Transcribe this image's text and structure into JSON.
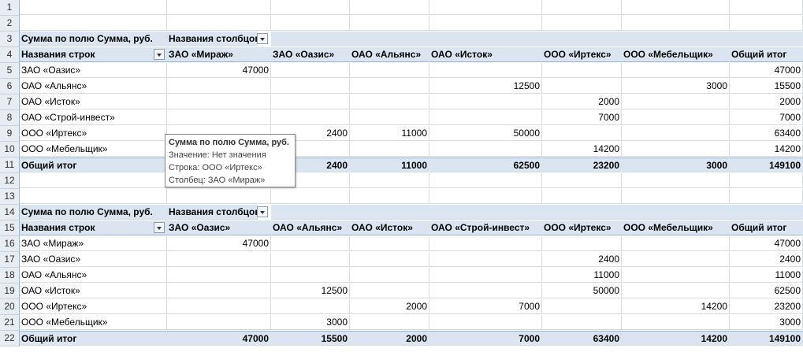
{
  "row_numbers": [
    "1",
    "2",
    "3",
    "4",
    "5",
    "6",
    "7",
    "8",
    "9",
    "10",
    "11",
    "12",
    "13",
    "14",
    "15",
    "16",
    "17",
    "18",
    "19",
    "20",
    "21",
    "22"
  ],
  "pivot1": {
    "data_label": "Сумма по полю Сумма, руб.",
    "columns_label": "Названия столбцов",
    "rows_label": "Названия строк",
    "columns": [
      "ЗАО «Мираж»",
      "ЗАО «Оазис»",
      "ОАО «Альянс»",
      "ОАО «Исток»",
      "ООО «Иртекс»",
      "ООО «Мебельщик»",
      "Общий итог"
    ],
    "rows": [
      {
        "label": "ЗАО «Оазис»",
        "v": [
          "47000",
          "",
          "",
          "",
          "",
          "",
          "47000"
        ]
      },
      {
        "label": "ОАО «Альянс»",
        "v": [
          "",
          "",
          "",
          "12500",
          "",
          "3000",
          "15500"
        ]
      },
      {
        "label": "ОАО «Исток»",
        "v": [
          "",
          "",
          "",
          "",
          "2000",
          "",
          "2000"
        ]
      },
      {
        "label": "ОАО «Строй-инвест»",
        "v": [
          "",
          "",
          "",
          "",
          "7000",
          "",
          "7000"
        ]
      },
      {
        "label": "ООО «Иртекс»",
        "v": [
          "",
          "2400",
          "11000",
          "50000",
          "",
          "",
          "63400"
        ]
      },
      {
        "label": "ООО «Мебельщик»",
        "v": [
          "",
          "",
          "",
          "",
          "14200",
          "",
          "14200"
        ]
      }
    ],
    "total": {
      "label": "Общий итог",
      "v": [
        "",
        "2400",
        "11000",
        "62500",
        "23200",
        "3000",
        "149100"
      ]
    }
  },
  "pivot2": {
    "data_label": "Сумма по полю Сумма, руб.",
    "columns_label": "Названия столбцов",
    "rows_label": "Названия строк",
    "columns": [
      "ЗАО «Оазис»",
      "ОАО «Альянс»",
      "ОАО «Исток»",
      "ОАО «Строй-инвест»",
      "ООО «Иртекс»",
      "ООО «Мебельщик»",
      "Общий итог"
    ],
    "rows": [
      {
        "label": "ЗАО «Мираж»",
        "v": [
          "47000",
          "",
          "",
          "",
          "",
          "",
          "47000"
        ]
      },
      {
        "label": "ЗАО «Оазис»",
        "v": [
          "",
          "",
          "",
          "",
          "2400",
          "",
          "2400"
        ]
      },
      {
        "label": "ОАО «Альянс»",
        "v": [
          "",
          "",
          "",
          "",
          "11000",
          "",
          "11000"
        ]
      },
      {
        "label": "ОАО «Исток»",
        "v": [
          "",
          "12500",
          "",
          "",
          "50000",
          "",
          "62500"
        ]
      },
      {
        "label": "ООО «Иртекс»",
        "v": [
          "",
          "",
          "2000",
          "7000",
          "",
          "14200",
          "23200"
        ]
      },
      {
        "label": "ООО «Мебельщик»",
        "v": [
          "",
          "3000",
          "",
          "",
          "",
          "",
          "3000"
        ]
      }
    ],
    "total": {
      "label": "Общий итог",
      "v": [
        "47000",
        "15500",
        "2000",
        "7000",
        "63400",
        "14200",
        "149100"
      ]
    }
  },
  "tooltip": {
    "title": "Сумма по полю Сумма, руб.",
    "value": "Значение: Нет значения",
    "row": "Строка: ООО «Иртекс»",
    "column": "Столбец: ЗАО «Мираж»"
  }
}
